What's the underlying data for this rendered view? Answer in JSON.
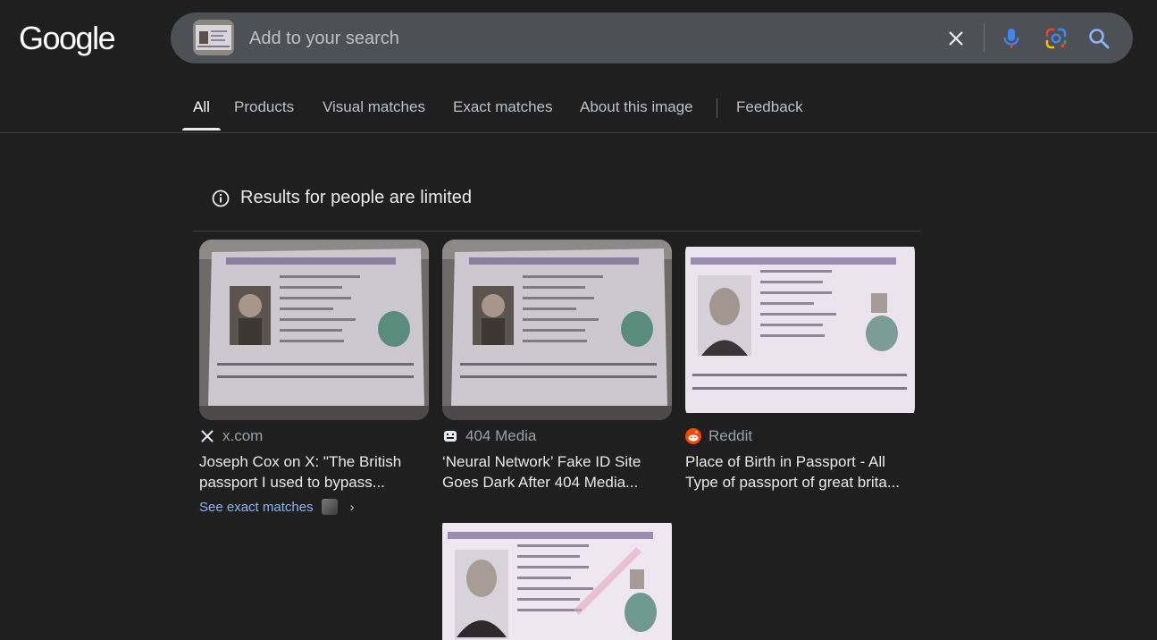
{
  "header": {
    "logo_text": "Google",
    "search_placeholder": "Add to your search"
  },
  "icons": {
    "clear": "close-icon",
    "mic": "microphone-icon",
    "lens": "google-lens-icon",
    "search": "search-icon",
    "notice": "info-icon"
  },
  "colors": {
    "background": "#1f1f1f",
    "search_bar": "#4d5156",
    "link": "#8ab4f8",
    "mic_blue": "#4285f4",
    "mic_red": "#ea4335"
  },
  "tabs": [
    {
      "label": "All",
      "active": true
    },
    {
      "label": "Products"
    },
    {
      "label": "Visual matches"
    },
    {
      "label": "Exact matches"
    },
    {
      "label": "About this image"
    },
    {
      "label": "Feedback"
    }
  ],
  "notice": {
    "text": "Results for people are limited"
  },
  "results": [
    {
      "source": "x.com",
      "title_line1": "Joseph Cox on X: \"The British",
      "title_line2": "passport I used to bypass...",
      "exact_link": "See exact matches",
      "thumb": "Photo of a UK passport data page with a man's photo"
    },
    {
      "source": "404 Media",
      "title_line1": "‘Neural Network’ Fake ID Site",
      "title_line2": "Goes Dark After 404 Media...",
      "thumb": "Photo of a UK passport data page with a man's photo"
    },
    {
      "source": "Reddit",
      "title_line1": "Place of Birth in Passport - All",
      "title_line2": "Type of passport of great brita...",
      "thumb": "UK specimen passport data page with a woman's photo"
    },
    {
      "thumb": "UK specimen passport data page with a woman's photo"
    }
  ]
}
